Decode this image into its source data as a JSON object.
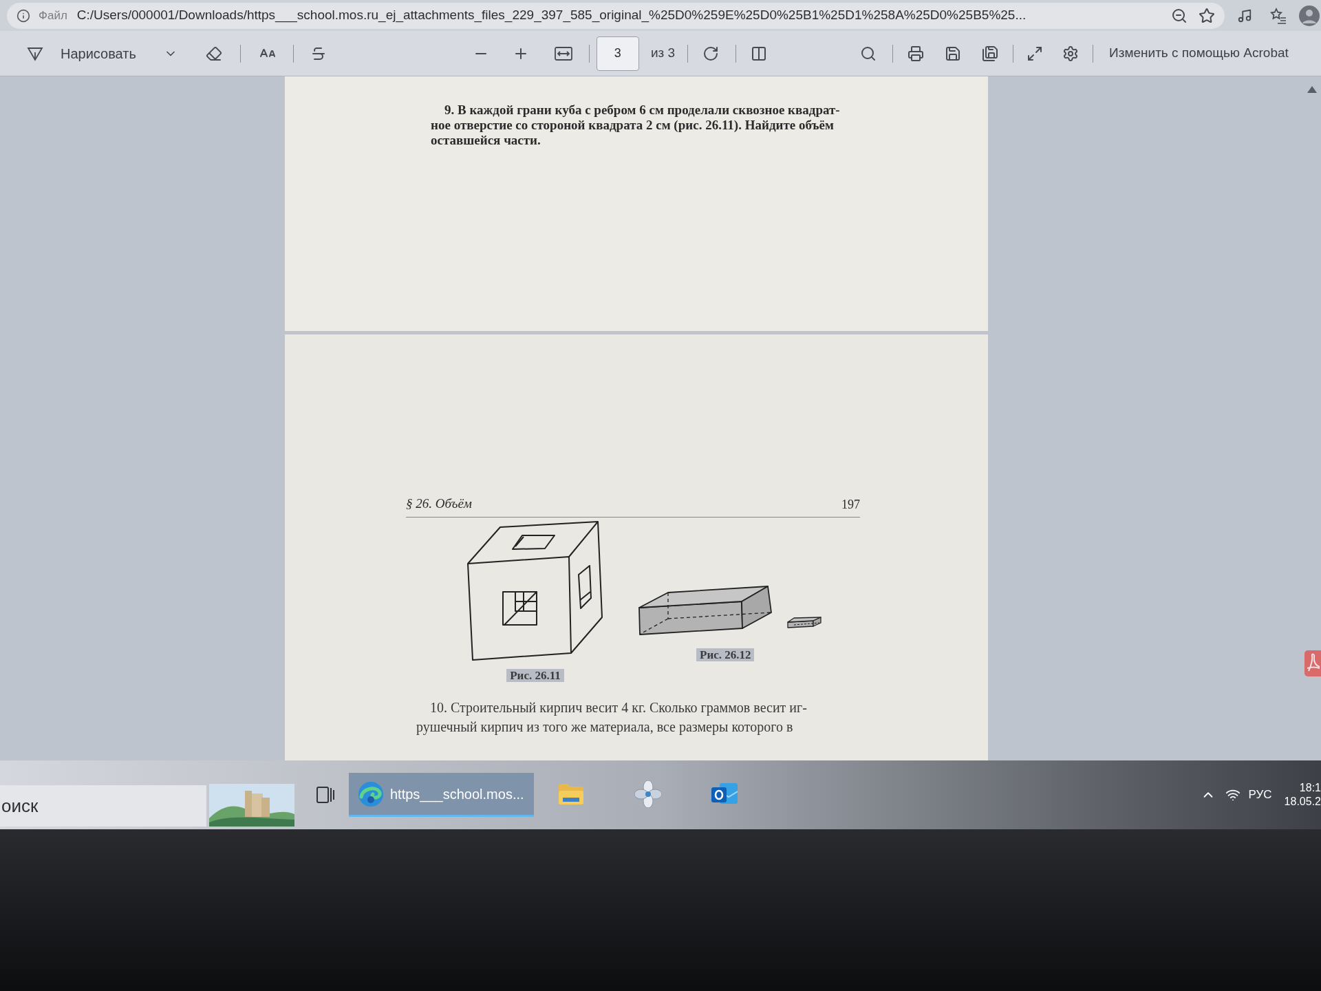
{
  "address_bar": {
    "file_label": "Файл",
    "url": "C:/Users/000001/Downloads/https___school.mos.ru_ej_attachments_files_229_397_585_original_%25D0%259E%25D0%25B1%25D1%258A%25D0%25B5%25..."
  },
  "pdf_toolbar": {
    "draw_button": "Нарисовать",
    "page_field": {
      "value": "3"
    },
    "page_count": "из 3",
    "edit_button": "Изменить с помощью Acrobat"
  },
  "pages": [
    {
      "kind": "text",
      "problem": "9. В каждой грани куба с ребром 6 см проделали сквозное квадрат-\nное отверстие со стороной квадрата 2 см (рис. 26.11). Найдите объём\nоставшейся части."
    },
    {
      "kind": "figures",
      "section_title": "§ 26. Объём",
      "page_number": "197",
      "figures": [
        {
          "kind": "cube",
          "caption": "Рис. 26.11"
        },
        {
          "kind": "bricks",
          "caption": "Рис. 26.12"
        }
      ],
      "problem": "10. Строительный кирпич весит 4 кг. Сколько граммов весит иг-\nрушечный кирпич из того же материала, все размеры которого в"
    }
  ],
  "taskbar": {
    "search": {
      "placeholder": "оиск"
    },
    "apps": [
      {
        "kind": "browser",
        "label": "https___school.mos...",
        "active": true
      },
      {
        "kind": "folder",
        "active": false
      },
      {
        "kind": "pinwheel",
        "active": false
      },
      {
        "kind": "mail",
        "active": false
      }
    ],
    "tray": {
      "language": "РУС",
      "time": "18:1",
      "date": "18.05.2"
    }
  }
}
